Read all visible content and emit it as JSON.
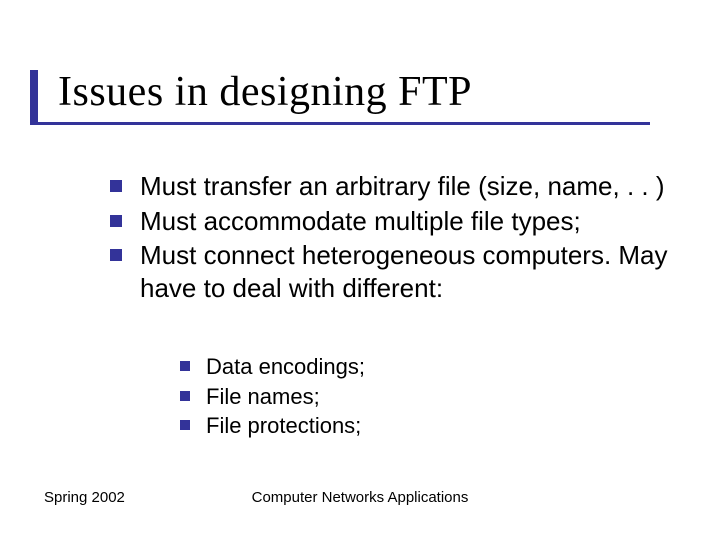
{
  "title": "Issues in designing FTP",
  "bullets": [
    "Must transfer an arbitrary file (size, name, . . )",
    "Must accommodate multiple file types;",
    "Must connect heterogeneous computers. May have to deal with different:"
  ],
  "sub_bullets": [
    "Data encodings;",
    "File names;",
    "File protections;"
  ],
  "footer": {
    "left": "Spring 2002",
    "center": "Computer Networks Applications"
  }
}
